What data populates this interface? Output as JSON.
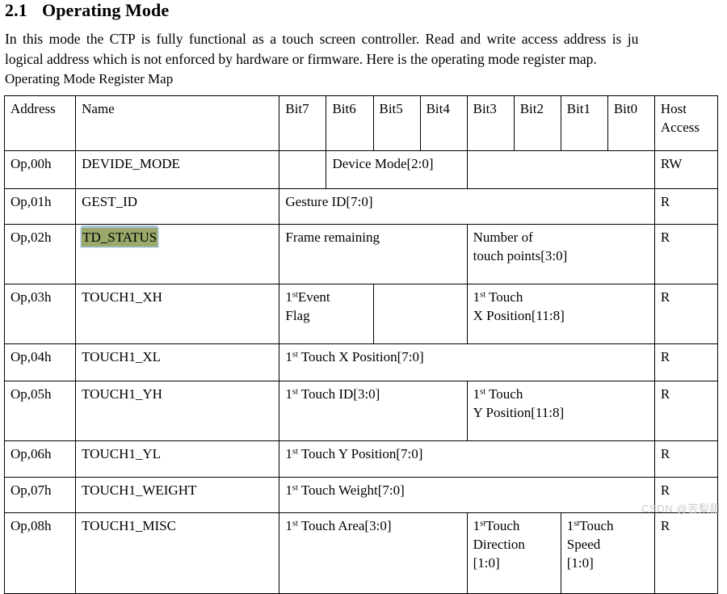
{
  "heading": {
    "number": "2.1",
    "title": "Operating Mode"
  },
  "paragraph": {
    "line1": "In this mode the CTP is fully functional as a touch screen controller. Read and write access address is ju",
    "line2": "logical address which is not enforced by hardware or firmware. Here is the operating mode register map."
  },
  "caption": "Operating Mode Register Map",
  "table": {
    "headers": {
      "address": "Address",
      "name": "Name",
      "bit7": "Bit7",
      "bit6": "Bit6",
      "bit5": "Bit5",
      "bit4": "Bit4",
      "bit3": "Bit3",
      "bit2": "Bit2",
      "bit1": "Bit1",
      "bit0": "Bit0",
      "host_line1": "Host",
      "host_line2": "Access"
    },
    "rows": [
      {
        "address": "Op,00h",
        "name": "DEVIDE_MODE",
        "fields": [
          {
            "text": "",
            "span": 1
          },
          {
            "text": "Device Mode[2:0]",
            "span": 3
          },
          {
            "text": "",
            "span": 4
          }
        ],
        "host": "RW",
        "highlight": false
      },
      {
        "address": "Op,01h",
        "name": "GEST_ID",
        "fields": [
          {
            "text": "Gesture ID[7:0]",
            "span": 8
          }
        ],
        "host": "R",
        "highlight": false
      },
      {
        "address": "Op,02h",
        "name": "TD_STATUS",
        "fields": [
          {
            "text": "Frame remaining",
            "span": 4
          },
          {
            "text": "Number of\ntouch points[3:0]",
            "span": 4
          }
        ],
        "host": "R",
        "highlight": true
      },
      {
        "address": "Op,03h",
        "name": "TOUCH1_XH",
        "fields": [
          {
            "text": "1^stEvent\nFlag",
            "span": 2
          },
          {
            "text": "",
            "span": 2
          },
          {
            "text": "1^st Touch\nX Position[11:8]",
            "span": 4
          }
        ],
        "host": "R",
        "highlight": false
      },
      {
        "address": "Op,04h",
        "name": "TOUCH1_XL",
        "fields": [
          {
            "text": "1^st Touch X Position[7:0]",
            "span": 8
          }
        ],
        "host": "R",
        "highlight": false
      },
      {
        "address": "Op,05h",
        "name": "TOUCH1_YH",
        "fields": [
          {
            "text": "1^st Touch ID[3:0]",
            "span": 4
          },
          {
            "text": "1^st Touch\nY Position[11:8]",
            "span": 4
          }
        ],
        "host": "R",
        "highlight": false
      },
      {
        "address": "Op,06h",
        "name": "TOUCH1_YL",
        "fields": [
          {
            "text": "1^st Touch Y Position[7:0]",
            "span": 8
          }
        ],
        "host": "R",
        "highlight": false
      },
      {
        "address": "Op,07h",
        "name": "TOUCH1_WEIGHT",
        "fields": [
          {
            "text": "1^st Touch Weight[7:0]",
            "span": 8
          }
        ],
        "host": "R",
        "highlight": false
      },
      {
        "address": "Op,08h",
        "name": "TOUCH1_MISC",
        "fields": [
          {
            "text": "1^st Touch Area[3:0]",
            "span": 4
          },
          {
            "text": "1^stTouch\nDirection\n[1:0]",
            "span": 2
          },
          {
            "text": "1^stTouch\nSpeed\n[1:0]",
            "span": 2
          }
        ],
        "host": "R",
        "highlight": false
      }
    ]
  },
  "watermark": "CSDN @苦梨甜",
  "colors": {
    "highlight_fill": "#9aa86a",
    "highlight_border": "#a8c4d8",
    "table_border": "#000000",
    "text": "#000000",
    "watermark": "#c9c9c9"
  }
}
